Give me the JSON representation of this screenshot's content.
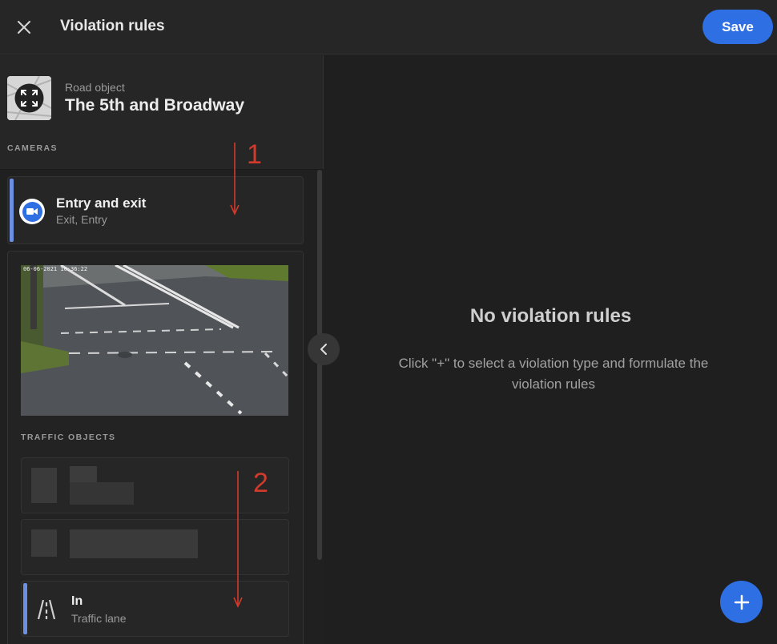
{
  "header": {
    "title": "Violation rules",
    "save_label": "Save",
    "close_icon": "close-icon"
  },
  "road_object": {
    "subtitle": "Road object",
    "name": "The 5th and Broadway",
    "icon": "fullscreen-icon"
  },
  "cameras": {
    "section_label": "CAMERAS",
    "items": [
      {
        "name": "Entry and exit",
        "zones": "Exit, Entry",
        "icon": "video-camera-icon"
      }
    ]
  },
  "camera_detail": {
    "timestamp": "06-06-2021 10:36:22",
    "traffic_objects_label": "TRAFFIC OBJECTS",
    "objects": [
      {
        "name": "In",
        "type": "Traffic lane",
        "icon": "lane-icon"
      }
    ]
  },
  "main": {
    "empty_title": "No violation rules",
    "empty_description": "Click \"+\" to select a violation type and formulate the violation rules"
  },
  "annotations": {
    "first": "1",
    "second": "2"
  },
  "colors": {
    "accent": "#2f6fe4",
    "selected_bar": "#6d8fe0",
    "annotation": "#d23a2c"
  }
}
